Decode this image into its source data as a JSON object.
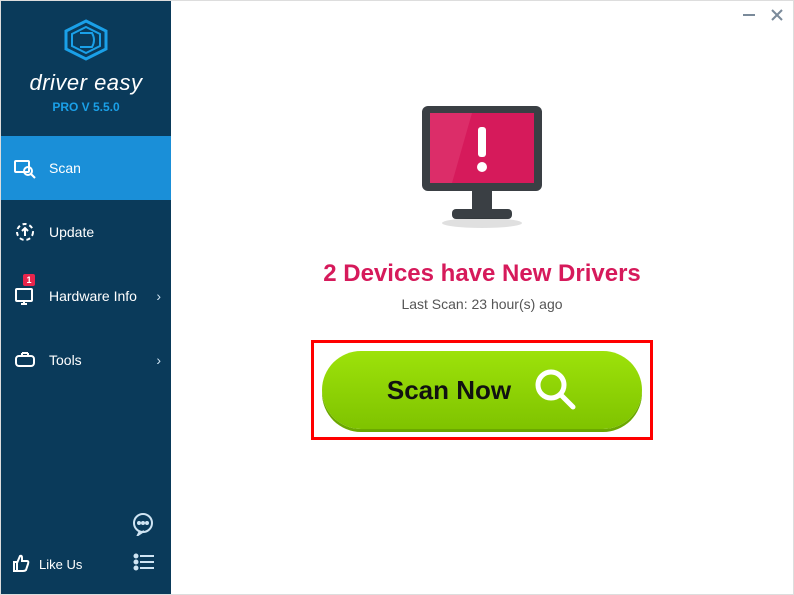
{
  "brand": {
    "name": "driver easy",
    "version": "PRO V 5.5.0"
  },
  "sidebar": {
    "items": [
      {
        "label": "Scan",
        "icon": "scan-icon",
        "active": true,
        "chevron": false,
        "badge": null
      },
      {
        "label": "Update",
        "icon": "update-icon",
        "active": false,
        "chevron": false,
        "badge": null
      },
      {
        "label": "Hardware Info",
        "icon": "hardware-icon",
        "active": false,
        "chevron": true,
        "badge": "1"
      },
      {
        "label": "Tools",
        "icon": "tools-icon",
        "active": false,
        "chevron": true,
        "badge": null
      }
    ],
    "like_us": "Like Us"
  },
  "main": {
    "status": "2 Devices have New Drivers",
    "last_scan": "Last Scan: 23 hour(s) ago",
    "scan_button": "Scan Now"
  },
  "colors": {
    "sidebar_bg": "#0a3a5a",
    "active_bg": "#1a8fd8",
    "accent_pink": "#d61a5b",
    "scan_green": "#8cd100"
  }
}
